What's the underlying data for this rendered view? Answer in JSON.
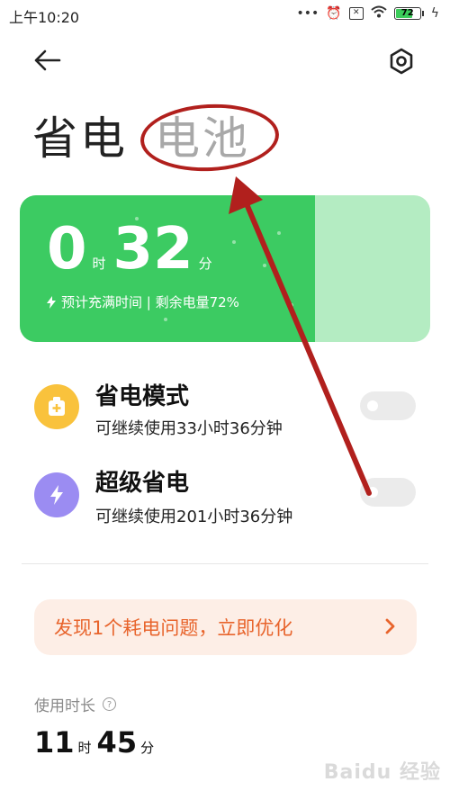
{
  "status_bar": {
    "time": "上午10:20",
    "battery_level": "72"
  },
  "header": {
    "title_prefix": "省电",
    "title_suffix": "电池"
  },
  "battery_card": {
    "hours": "0",
    "hours_unit": "时",
    "minutes": "32",
    "minutes_unit": "分",
    "subtitle": "预计充满时间 | 剩余电量72%",
    "charge_fraction": 0.72
  },
  "modes": [
    {
      "title": "省电模式",
      "subtitle": "可继续使用33小时36分钟",
      "enabled": false,
      "color": "#f9c23c"
    },
    {
      "title": "超级省电",
      "subtitle": "可继续使用201小时36分钟",
      "enabled": false,
      "color": "#9b8cf2"
    }
  ],
  "issue_banner": {
    "text": "发现1个耗电问题，立即优化"
  },
  "usage": {
    "label": "使用时长",
    "help": "?",
    "hours": "11",
    "hours_unit": "时",
    "minutes": "45",
    "minutes_unit": "分"
  },
  "watermark": "Baidu 经验",
  "colors": {
    "card_green": "#3ccb62",
    "card_light": "#b4ecc2",
    "annotation_red": "#b1201d",
    "issue_text": "#e8642c"
  }
}
